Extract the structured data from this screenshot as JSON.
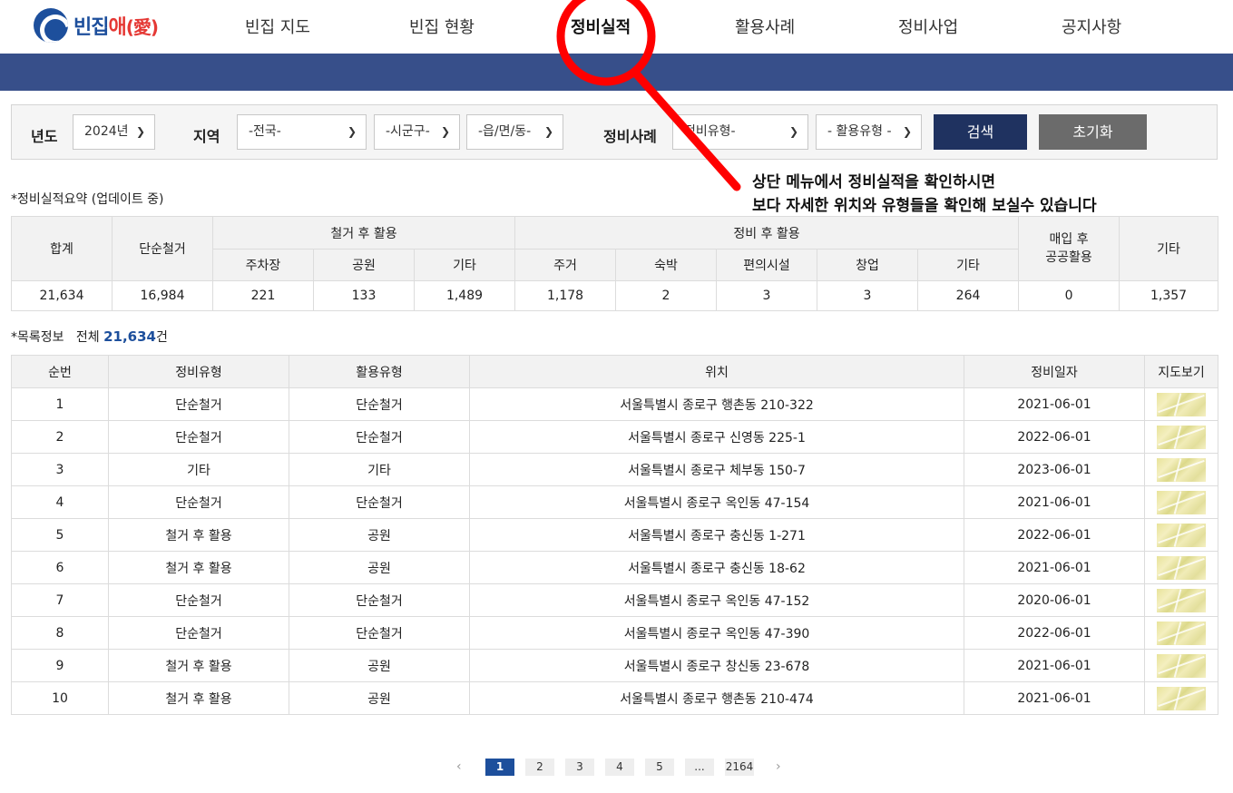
{
  "logo": {
    "text_main": "빈집",
    "text_ae": "애",
    "text_han": "(愛)"
  },
  "nav": [
    "빈집 지도",
    "빈집 현황",
    "정비실적",
    "활용사례",
    "정비사업",
    "공지사항"
  ],
  "nav_active_index": 2,
  "search": {
    "year_label": "년도",
    "year_value": "2024년",
    "region_label": "지역",
    "sido_value": "-전국-",
    "sigungu_value": "-시군구-",
    "emd_value": "-읍/면/동-",
    "case_label": "정비사례",
    "type_value": "정비유형-",
    "use_value": "- 활용유형 -",
    "search_button": "검색",
    "reset_button": "초기화"
  },
  "annotation": {
    "line1": "상단 메뉴에서 정비실적을 확인하시면",
    "line2": "보다 자세한 위치와 유형들을 확인해 보실수 있습니다",
    "color": "#ff0000"
  },
  "summary": {
    "caption": "*정비실적요약 (업데이트 중)",
    "h_total": "합계",
    "h_simple": "단순철거",
    "h_after_demolish": "철거 후 활용",
    "h_after_repair": "정비 후 활용",
    "h_purchase": "매입 후 공공활용",
    "h_other": "기타",
    "sub_demolish": [
      "주차장",
      "공원",
      "기타"
    ],
    "sub_repair": [
      "주거",
      "숙박",
      "편의시설",
      "창업",
      "기타"
    ],
    "values": [
      "21,634",
      "16,984",
      "221",
      "133",
      "1,489",
      "1,178",
      "2",
      "3",
      "3",
      "264",
      "0",
      "1,357"
    ]
  },
  "list": {
    "caption": "*목록정보",
    "total_prefix": "전체",
    "total_count": "21,634",
    "total_suffix": "건",
    "headers": [
      "순번",
      "정비유형",
      "활용유형",
      "위치",
      "정비일자",
      "지도보기"
    ],
    "rows": [
      [
        "1",
        "단순철거",
        "단순철거",
        "서울특별시 종로구 행촌동 210-322",
        "2021-06-01"
      ],
      [
        "2",
        "단순철거",
        "단순철거",
        "서울특별시 종로구 신영동 225-1",
        "2022-06-01"
      ],
      [
        "3",
        "기타",
        "기타",
        "서울특별시 종로구 체부동 150-7",
        "2023-06-01"
      ],
      [
        "4",
        "단순철거",
        "단순철거",
        "서울특별시 종로구 옥인동 47-154",
        "2021-06-01"
      ],
      [
        "5",
        "철거 후 활용",
        "공원",
        "서울특별시 종로구 충신동 1-271",
        "2022-06-01"
      ],
      [
        "6",
        "철거 후 활용",
        "공원",
        "서울특별시 종로구 충신동 18-62",
        "2021-06-01"
      ],
      [
        "7",
        "단순철거",
        "단순철거",
        "서울특별시 종로구 옥인동 47-152",
        "2020-06-01"
      ],
      [
        "8",
        "단순철거",
        "단순철거",
        "서울특별시 종로구 옥인동 47-390",
        "2022-06-01"
      ],
      [
        "9",
        "철거 후 활용",
        "공원",
        "서울특별시 종로구 창신동 23-678",
        "2021-06-01"
      ],
      [
        "10",
        "철거 후 활용",
        "공원",
        "서울특별시 종로구 행촌동 210-474",
        "2021-06-01"
      ]
    ]
  },
  "pagination": {
    "prev": "‹",
    "pages": [
      "1",
      "2",
      "3",
      "4",
      "5",
      "...",
      "2164"
    ],
    "current": "1",
    "next": "›"
  }
}
